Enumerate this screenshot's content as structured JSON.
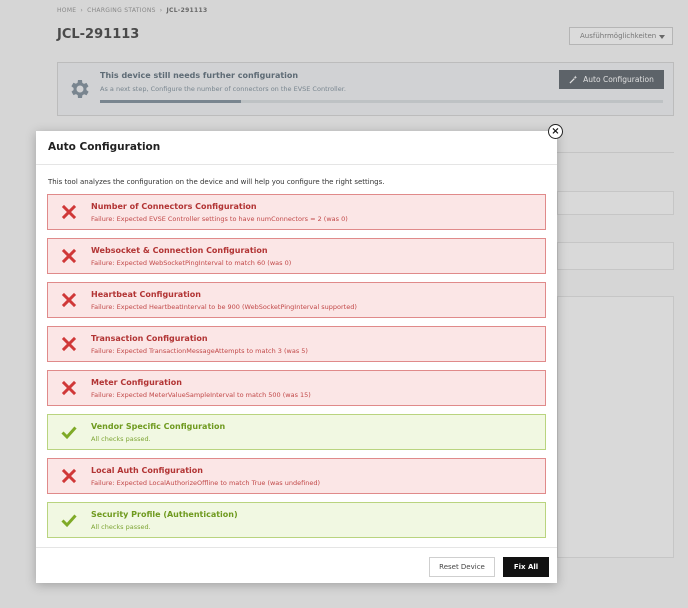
{
  "breadcrumb": {
    "items": [
      "HOME",
      "CHARGING STATIONS"
    ],
    "separator": "›",
    "current": "JCL-291113"
  },
  "page": {
    "title": "JCL-291113",
    "actions_label": "Ausführmöglichkeiten"
  },
  "banner": {
    "title": "This device still needs further configuration",
    "subtitle": "As a next step, Configure the number of connectors on the EVSE Controller.",
    "button_label": "Auto Configuration",
    "progress": 0.25
  },
  "modal": {
    "title": "Auto Configuration",
    "intro": "This tool analyzes the configuration on the device and will help you configure the right settings.",
    "checks": [
      {
        "status": "fail",
        "title": "Number of Connectors Configuration",
        "message": "Failure: Expected EVSE Controller settings to have numConnectors = 2 (was 0)"
      },
      {
        "status": "fail",
        "title": "Websocket & Connection Configuration",
        "message": "Failure: Expected WebSocketPingInterval to match 60 (was 0)"
      },
      {
        "status": "fail",
        "title": "Heartbeat Configuration",
        "message": "Failure: Expected HeartbeatInterval to be 900 (WebSocketPingInterval supported)"
      },
      {
        "status": "fail",
        "title": "Transaction Configuration",
        "message": "Failure: Expected TransactionMessageAttempts to match 3 (was 5)"
      },
      {
        "status": "fail",
        "title": "Meter Configuration",
        "message": "Failure: Expected MeterValueSampleInterval to match 500 (was 15)"
      },
      {
        "status": "pass",
        "title": "Vendor Specific Configuration",
        "message": "All checks passed."
      },
      {
        "status": "fail",
        "title": "Local Auth Configuration",
        "message": "Failure: Expected LocalAuthorizeOffline to match True (was undefined)"
      },
      {
        "status": "pass",
        "title": "Security Profile (Authentication)",
        "message": "All checks passed."
      }
    ],
    "reset_label": "Reset Device",
    "fix_label": "Fix All",
    "close_symbol": "×"
  },
  "icons": {
    "fail": "x-icon",
    "pass": "checkmark-icon",
    "banner": "gear-icon",
    "auto": "magic-wand-icon"
  },
  "colors": {
    "fail": "#d03838",
    "pass": "#7faa27",
    "primary": "#111111"
  }
}
